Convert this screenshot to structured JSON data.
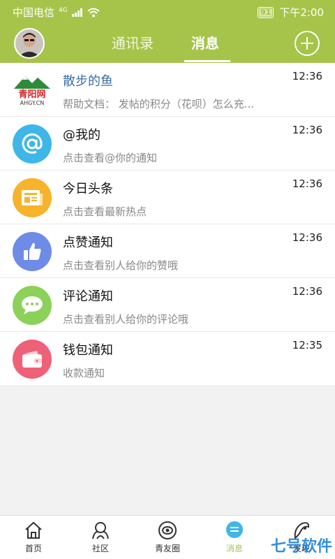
{
  "status": {
    "carrier": "中国电信",
    "network": "4G",
    "battery": "91",
    "time": "下午2:00"
  },
  "header": {
    "tabs": [
      {
        "label": "通讯录",
        "active": false
      },
      {
        "label": "消息",
        "active": true
      }
    ]
  },
  "messages": [
    {
      "title": "散步的鱼",
      "subtitle": "帮助文档： 发帖的积分（花呗）怎么充...",
      "time": "12:36",
      "icon": "qingyang-logo",
      "logo_text": "青阳网",
      "logo_sub": "AHGY.CN"
    },
    {
      "title": "@我的",
      "subtitle": "点击查看@你的通知",
      "time": "12:36",
      "icon": "at-icon",
      "color": "#3fb6e8"
    },
    {
      "title": "今日头条",
      "subtitle": "点击查看最新热点",
      "time": "12:36",
      "icon": "newspaper-icon",
      "color": "#f7b32b"
    },
    {
      "title": "点赞通知",
      "subtitle": "点击查看别人给你的赞哦",
      "time": "12:36",
      "icon": "thumbs-up-icon",
      "color": "#6f8be8"
    },
    {
      "title": "评论通知",
      "subtitle": "点击查看别人给你的评论哦",
      "time": "12:36",
      "icon": "comment-icon",
      "color": "#8bd15a"
    },
    {
      "title": "钱包通知",
      "subtitle": "收款通知",
      "time": "12:35",
      "icon": "wallet-icon",
      "color": "#ef6178"
    }
  ],
  "bottom_nav": [
    {
      "label": "首页",
      "icon": "home-icon"
    },
    {
      "label": "社区",
      "icon": "community-icon"
    },
    {
      "label": "青友圈",
      "icon": "moments-icon"
    },
    {
      "label": "消息",
      "icon": "message-icon",
      "active": true
    },
    {
      "label": "发现",
      "icon": "discover-icon"
    }
  ],
  "watermark": "七号软件",
  "colors": {
    "accent": "#a6c449"
  }
}
